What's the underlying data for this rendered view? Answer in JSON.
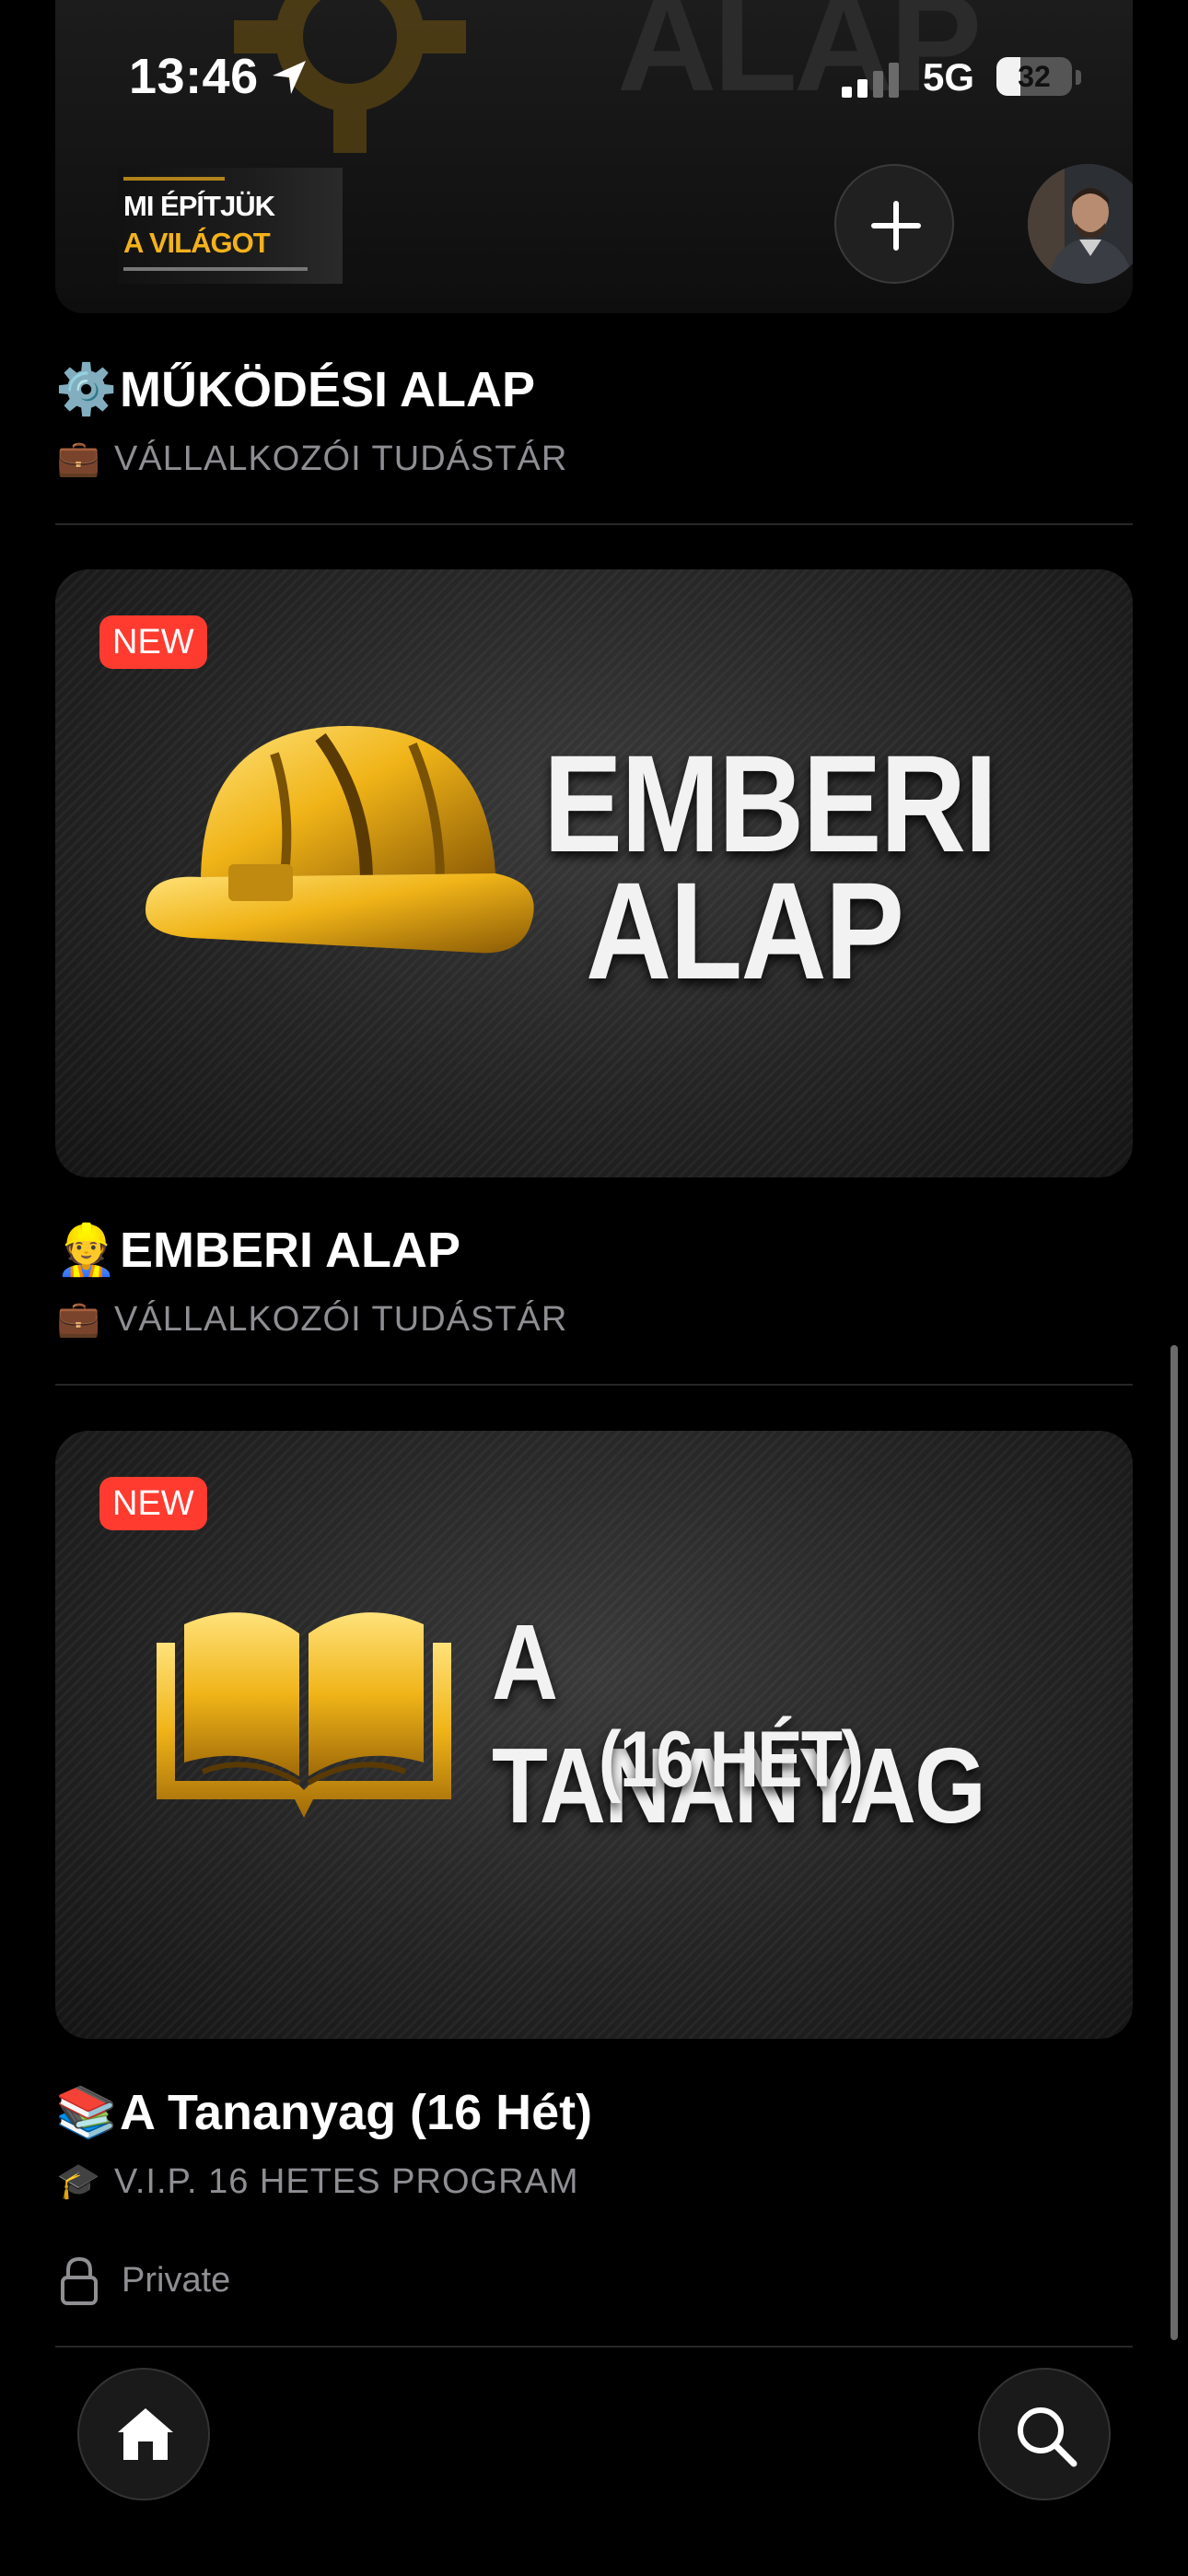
{
  "status_bar": {
    "time": "13:46",
    "network": "5G",
    "battery": "32",
    "battery_fraction": 0.32
  },
  "header": {
    "banner_word": "ALAP",
    "logo": {
      "line1": "MI ÉPÍTJÜK",
      "line2": "A VILÁGOT"
    },
    "icons": {
      "add": "plus-icon",
      "avatar": "profile-photo"
    }
  },
  "sections": [
    {
      "emoji": "⚙️",
      "title": "MŰKÖDÉSI ALAP",
      "sub_emoji": "💼",
      "subtitle": "VÁLLALKOZÓI TUDÁSTÁR"
    },
    {
      "badge": "NEW",
      "card_line1": "EMBERI",
      "card_line2": "ALAP",
      "card_icon": "hard-hat",
      "emoji": "👷",
      "title": "EMBERI ALAP",
      "sub_emoji": "💼",
      "subtitle": "VÁLLALKOZÓI TUDÁSTÁR"
    },
    {
      "badge": "NEW",
      "card_line1": "A TANANYAG",
      "card_line2": "(16 HÉT)",
      "card_icon": "open-book",
      "emoji": "📚",
      "title": "A Tananyag (16 Hét)",
      "sub_emoji": "🎓",
      "subtitle": "V.I.P. 16 HETES PROGRAM",
      "privacy": "Private"
    }
  ],
  "bottom_nav": {
    "home": "home-icon",
    "search": "search-icon"
  },
  "colors": {
    "background": "#000000",
    "badge": "#ff3b30",
    "gold": "#f3b21c",
    "muted_text": "#8e8e93"
  }
}
